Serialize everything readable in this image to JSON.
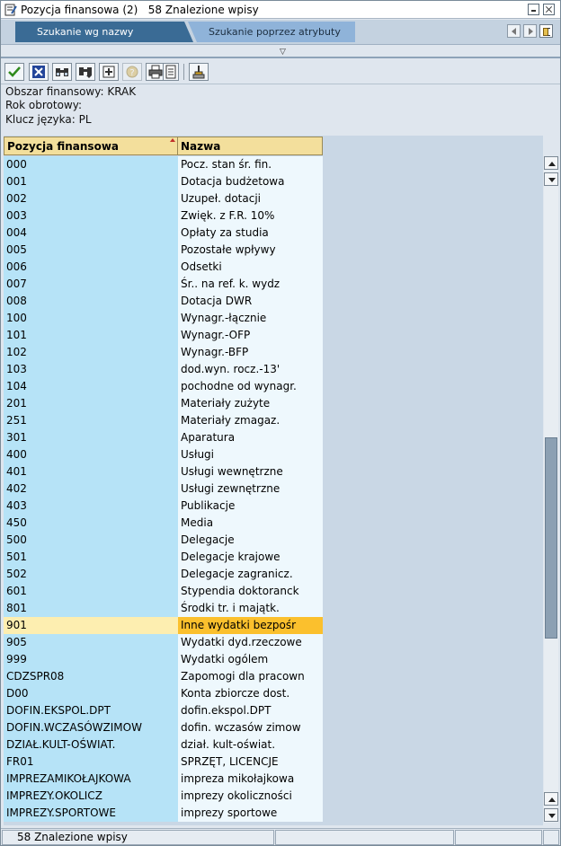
{
  "window": {
    "title": "Pozycja finansowa (2)   58 Znalezione wpisy"
  },
  "tabs": [
    {
      "label": "Szukanie wg nazwy",
      "active": true
    },
    {
      "label": "Szukanie poprzez atrybuty",
      "active": false
    }
  ],
  "toolbar": {
    "icons": [
      "check-icon",
      "cancel-icon",
      "find-icon",
      "find-next-icon",
      "select-icon",
      "help-icon",
      "print-icon",
      "info-icon",
      "personalize-icon"
    ]
  },
  "info": {
    "line1": "Obszar finansowy: KRAK",
    "line2": "Rok obrotowy:",
    "line3": "Klucz języka: PL"
  },
  "table": {
    "headers": [
      "Pozycja finansowa",
      "Nazwa"
    ],
    "selected_index": 27,
    "rows": [
      [
        "000",
        "Pocz. stan śr. fin."
      ],
      [
        "001",
        "Dotacja budżetowa"
      ],
      [
        "002",
        "Uzupeł. dotacji"
      ],
      [
        "003",
        "Zwięk. z F.R. 10%"
      ],
      [
        "004",
        "Opłaty za studia"
      ],
      [
        "005",
        "Pozostałe wpływy"
      ],
      [
        "006",
        "Odsetki"
      ],
      [
        "007",
        "Śr.. na ref. k. wydz"
      ],
      [
        "008",
        "Dotacja DWR"
      ],
      [
        "100",
        "Wynagr.-łącznie"
      ],
      [
        "101",
        "Wynagr.-OFP"
      ],
      [
        "102",
        "Wynagr.-BFP"
      ],
      [
        "103",
        "dod.wyn. rocz.-13'"
      ],
      [
        "104",
        "pochodne od wynagr."
      ],
      [
        "201",
        "Materiały zużyte"
      ],
      [
        "251",
        "Materiały zmagaz."
      ],
      [
        "301",
        "Aparatura"
      ],
      [
        "400",
        "Usługi"
      ],
      [
        "401",
        "Usługi wewnętrzne"
      ],
      [
        "402",
        "Usługi zewnętrzne"
      ],
      [
        "403",
        "Publikacje"
      ],
      [
        "450",
        "Media"
      ],
      [
        "500",
        "Delegacje"
      ],
      [
        "501",
        "Delegacje krajowe"
      ],
      [
        "502",
        "Delegacje zagranicz."
      ],
      [
        "601",
        "Stypendia doktoranck"
      ],
      [
        "801",
        "Środki tr. i majątk."
      ],
      [
        "901",
        "Inne wydatki bezpośr"
      ],
      [
        "905",
        "Wydatki dyd.rzeczowe"
      ],
      [
        "999",
        "Wydatki ogólem"
      ],
      [
        "CDZSPR08",
        "Zapomogi dla pracown"
      ],
      [
        "D00",
        "Konta zbiorcze dost."
      ],
      [
        "DOFIN.EKSPOL.DPT",
        "dofin.ekspol.DPT"
      ],
      [
        "DOFIN.WCZASÓWZIMOW",
        "dofin. wczasów zimow"
      ],
      [
        "DZIAŁ.KULT-OŚWIAT.",
        "dział. kult-oświat."
      ],
      [
        "FR01",
        "SPRZĘT, LICENCJE"
      ],
      [
        "IMPREZAMIKOŁAJKOWA",
        "impreza mikołajkowa"
      ],
      [
        "IMPREZY.OKOLICZ",
        "imprezy okoliczności"
      ],
      [
        "IMPREZY.SPORTOWE",
        "imprezy sportowe"
      ]
    ]
  },
  "scrollbar": {
    "position_fraction": 0.62
  },
  "status": {
    "text": "58 Znalezione wpisy"
  }
}
